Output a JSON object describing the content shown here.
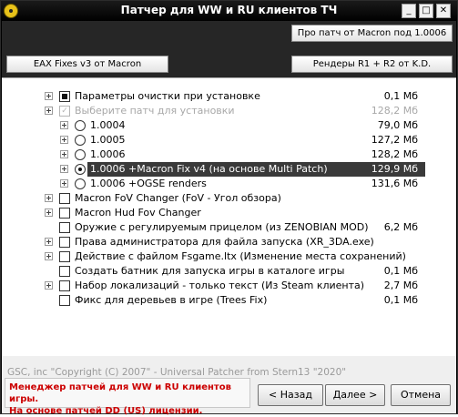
{
  "window": {
    "title": "Патчер для WW и RU клиентов ТЧ",
    "controls": {
      "minimize": "_",
      "maximize": "□",
      "close": "✕"
    }
  },
  "banner": {
    "macron_patch_button": "Про патч от Macron под 1.0006",
    "eax_button": "EAX Fixes v3 от Macron",
    "renders_button": "Рендеры R1 + R2 от K.D."
  },
  "tree": {
    "items": [
      {
        "label": "Параметры очистки при установке",
        "size": "0,1 Мб"
      },
      {
        "label": "Выберите патч для установки",
        "size": "128,2 Мб"
      },
      {
        "label": "1.0004",
        "size": "79,0 Мб"
      },
      {
        "label": "1.0005",
        "size": "127,2 Мб"
      },
      {
        "label": "1.0006",
        "size": "128,2 Мб"
      },
      {
        "label": "1.0006 +Macron Fix v4 (на основе Multi Patch)",
        "size": "129,9 Мб"
      },
      {
        "label": "1.0006 +OGSE renders",
        "size": "131,6 Мб"
      },
      {
        "label": "Macron FoV Changer (FoV - Угол обзора)",
        "size": ""
      },
      {
        "label": "Macron Hud Fov Changer",
        "size": ""
      },
      {
        "label": "Оружие с регулируемым прицелом (из ZENOBIAN MOD)",
        "size": "6,2 Мб"
      },
      {
        "label": "Права администратора для файла запуска (XR_3DA.exe)",
        "size": ""
      },
      {
        "label": "Действие с файлом Fsgame.ltx (Изменение места сохранений)",
        "size": ""
      },
      {
        "label": "Создать батник для запуска игры в каталоге игры",
        "size": "0,1 Мб"
      },
      {
        "label": "Набор локализаций - только текст (Из Steam клиента)",
        "size": "2,7 Мб"
      },
      {
        "label": "Фикс для деревьев в игре (Trees Fix)",
        "size": "0,1 Мб"
      }
    ]
  },
  "footer": {
    "copyright": "GSC, inc \"Copyright (C) 2007\" - Universal Patcher from Stern13 \"2020\"",
    "info_line1": "Менеджер патчей для WW и RU клиентов игры.",
    "info_line2": "На основе патчей DD (US) лицензии.",
    "back": "< Назад",
    "next": "Далее >",
    "cancel": "Отмена"
  }
}
